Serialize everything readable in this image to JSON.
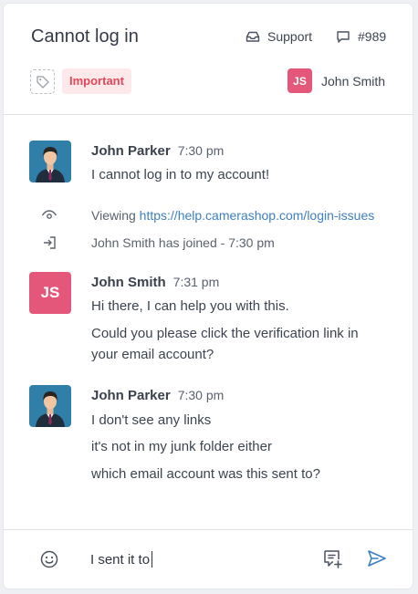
{
  "header": {
    "title": "Cannot log in",
    "channel": "Support",
    "ticket_number": "#989",
    "tag": "Important",
    "assignee": {
      "initials": "JS",
      "name": "John Smith"
    }
  },
  "messages": [
    {
      "author": "John Parker",
      "time": "7:30 pm",
      "lines": [
        "I cannot log in to my account!"
      ]
    },
    {
      "author": "John Smith",
      "initials": "JS",
      "time": "7:31 pm",
      "lines": [
        "Hi there, I can help you with this.",
        "Could you please click the verification link in",
        "your email account?"
      ]
    },
    {
      "author": "John Parker",
      "time": "7:30 pm",
      "lines": [
        "I don't see any links",
        "it's not in my junk folder either",
        "which email account was this sent to?"
      ]
    }
  ],
  "events": {
    "viewing_label": "Viewing",
    "viewing_url": "https://help.camerashop.com/login-issues",
    "joined": "John Smith has joined - 7:30 pm"
  },
  "composer": {
    "value": "I sent it to"
  },
  "colors": {
    "accent": "#3d7fc3",
    "avatar": "#e4577a",
    "badge_bg": "#fde8ea",
    "badge_text": "#e0475a"
  }
}
